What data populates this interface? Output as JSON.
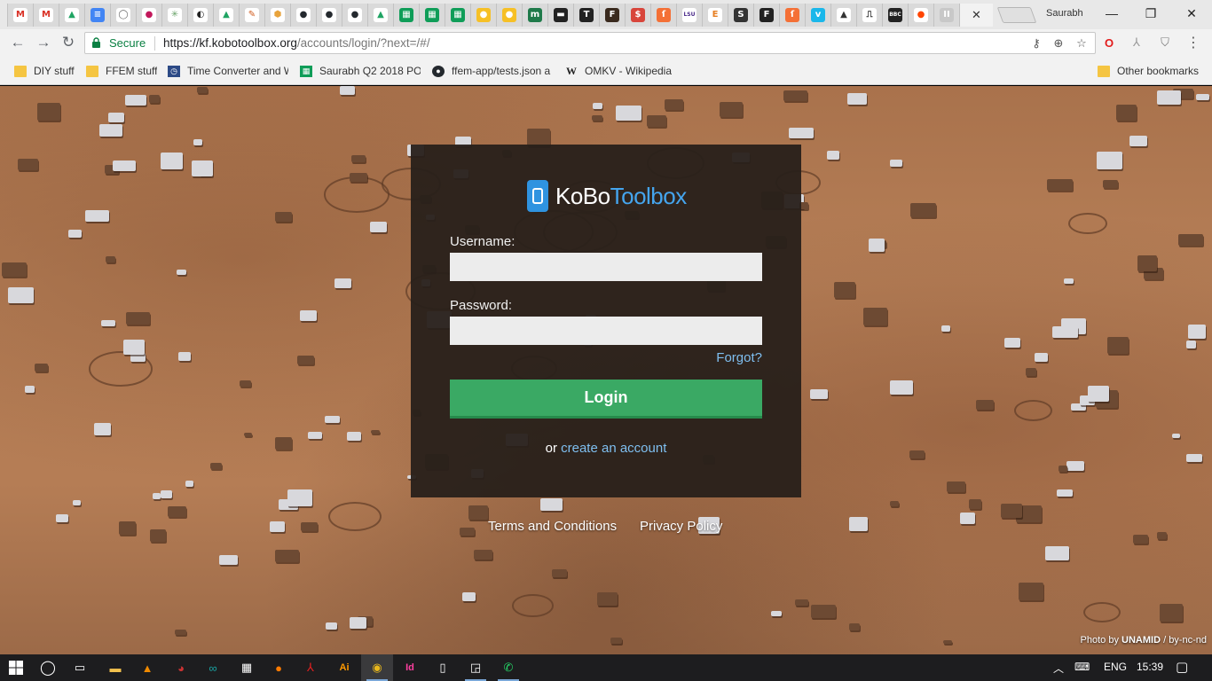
{
  "browser": {
    "tabs": [
      {
        "icon": "gmail-icon",
        "glyph": "M",
        "bg": "#ffffff",
        "fg": "#d93025"
      },
      {
        "icon": "gmail-icon",
        "glyph": "M",
        "bg": "#ffffff",
        "fg": "#d93025"
      },
      {
        "icon": "google-drive-icon",
        "glyph": "▲",
        "bg": "#ffffff",
        "fg": "#1fa463"
      },
      {
        "icon": "google-docs-icon",
        "glyph": "≡",
        "bg": "#4285f4",
        "fg": "#ffffff"
      },
      {
        "icon": "chat-bubble-icon",
        "glyph": "◯",
        "bg": "#ffffff",
        "fg": "#666666"
      },
      {
        "icon": "circle-logo-icon",
        "glyph": "●",
        "bg": "#ffffff",
        "fg": "#c2185b"
      },
      {
        "icon": "globe-icon",
        "glyph": "✳",
        "bg": "#ffffff",
        "fg": "#6aa36a"
      },
      {
        "icon": "swirl-icon",
        "glyph": "◐",
        "bg": "#ffffff",
        "fg": "#222222"
      },
      {
        "icon": "google-drive-icon",
        "glyph": "▲",
        "bg": "#ffffff",
        "fg": "#1fa463"
      },
      {
        "icon": "pen-icon",
        "glyph": "✎",
        "bg": "#ffffff",
        "fg": "#d05c1e"
      },
      {
        "icon": "hexagon-icon",
        "glyph": "⬢",
        "bg": "#ffffff",
        "fg": "#e8a33c"
      },
      {
        "icon": "github-icon",
        "glyph": "●",
        "bg": "#ffffff",
        "fg": "#24292e"
      },
      {
        "icon": "github-icon",
        "glyph": "●",
        "bg": "#ffffff",
        "fg": "#24292e"
      },
      {
        "icon": "github-icon",
        "glyph": "●",
        "bg": "#ffffff",
        "fg": "#24292e"
      },
      {
        "icon": "google-drive-icon",
        "glyph": "▲",
        "bg": "#ffffff",
        "fg": "#1fa463"
      },
      {
        "icon": "google-sheets-icon",
        "glyph": "▦",
        "bg": "#0f9d58",
        "fg": "#ffffff"
      },
      {
        "icon": "google-sheets-icon",
        "glyph": "▦",
        "bg": "#0f9d58",
        "fg": "#ffffff"
      },
      {
        "icon": "google-sheets-icon",
        "glyph": "▦",
        "bg": "#0f9d58",
        "fg": "#ffffff"
      },
      {
        "icon": "lightbulb-icon",
        "glyph": "●",
        "bg": "#f6c026",
        "fg": "#ffffff"
      },
      {
        "icon": "lightbulb-icon",
        "glyph": "●",
        "bg": "#f6c026",
        "fg": "#ffffff"
      },
      {
        "icon": "m-letter-icon",
        "glyph": "m",
        "bg": "#1f7a4a",
        "fg": "#ffffff"
      },
      {
        "icon": "dark-app-icon",
        "glyph": "▬",
        "bg": "#222222",
        "fg": "#ffffff"
      },
      {
        "icon": "t-letter-icon",
        "glyph": "T",
        "bg": "#222222",
        "fg": "#ffffff"
      },
      {
        "icon": "book-icon",
        "glyph": "F",
        "bg": "#3a2a1e",
        "fg": "#ffffff"
      },
      {
        "icon": "dollar-icon",
        "glyph": "$",
        "bg": "#d8453b",
        "fg": "#ffffff"
      },
      {
        "icon": "script-icon",
        "glyph": "ſ",
        "bg": "#f47036",
        "fg": "#ffffff"
      },
      {
        "icon": "lsu-icon",
        "glyph": "LSU",
        "bg": "#ffffff",
        "fg": "#4a2a8a"
      },
      {
        "icon": "e-letter-icon",
        "glyph": "E",
        "bg": "#ffffff",
        "fg": "#e67e22"
      },
      {
        "icon": "ssh-icon",
        "glyph": "S",
        "bg": "#333333",
        "fg": "#ffffff"
      },
      {
        "icon": "f-letter-icon",
        "glyph": "F",
        "bg": "#222222",
        "fg": "#ffffff"
      },
      {
        "icon": "script-icon",
        "glyph": "ſ",
        "bg": "#f47036",
        "fg": "#ffffff"
      },
      {
        "icon": "vimeo-icon",
        "glyph": "v",
        "bg": "#1ab7ea",
        "fg": "#ffffff"
      },
      {
        "icon": "mountain-icon",
        "glyph": "▲",
        "bg": "#ffffff",
        "fg": "#333333"
      },
      {
        "icon": "pulse-icon",
        "glyph": "⎍",
        "bg": "#ffffff",
        "fg": "#222222"
      },
      {
        "icon": "bbc-icon",
        "glyph": "BBC",
        "bg": "#222222",
        "fg": "#ffffff"
      },
      {
        "icon": "reddit-icon",
        "glyph": "●",
        "bg": "#ffffff",
        "fg": "#ff4500"
      },
      {
        "icon": "pause-icon",
        "glyph": "II",
        "bg": "#c8c8c8",
        "fg": "#ffffff"
      }
    ],
    "active_tab_close": "✕",
    "profile_name": "Saurabh",
    "window": {
      "minimize": "—",
      "restore": "❐",
      "close": "✕"
    },
    "address": {
      "secure_label": "Secure",
      "url_host": "https://kf.kobotoolbox.org",
      "url_path": "/accounts/login/?next=/#/"
    },
    "bookmarks": [
      {
        "label": "DIY stuff",
        "kind": "folder"
      },
      {
        "label": "FFEM stuff",
        "kind": "folder"
      },
      {
        "label": "Time Converter and W",
        "kind": "link",
        "icon": "clock-icon",
        "bg": "#2c4a86",
        "glyph": "◷"
      },
      {
        "label": "Saurabh Q2 2018 PO",
        "kind": "link",
        "icon": "google-sheets-icon",
        "bg": "#0f9d58",
        "glyph": "▦"
      },
      {
        "label": "ffem-app/tests.json a",
        "kind": "link",
        "icon": "github-icon",
        "bg": "#24292e",
        "glyph": "●"
      },
      {
        "label": "OMKV - Wikipedia",
        "kind": "link",
        "icon": "wikipedia-icon",
        "bg": "#ffffff",
        "glyph": "W"
      }
    ],
    "other_bookmarks": "Other bookmarks"
  },
  "login": {
    "brand_part1": "KoBo",
    "brand_part2": "Toolbox",
    "username_label": "Username:",
    "username_value": "",
    "password_label": "Password:",
    "password_value": "",
    "forgot_label": "Forgot?",
    "login_button": "Login",
    "signup_prefix": "or",
    "signup_link": "create an account"
  },
  "footer": {
    "terms": "Terms and Conditions",
    "privacy": "Privacy Policy"
  },
  "credit": {
    "prefix": "Photo by",
    "author": "UNAMID",
    "license": "/ by-nc-nd"
  },
  "colors": {
    "accent_green": "#3aa964",
    "link_blue": "#7fbff0",
    "brand_blue": "#2f93e0"
  },
  "taskbar": {
    "language": "ENG",
    "time": "15:39"
  }
}
